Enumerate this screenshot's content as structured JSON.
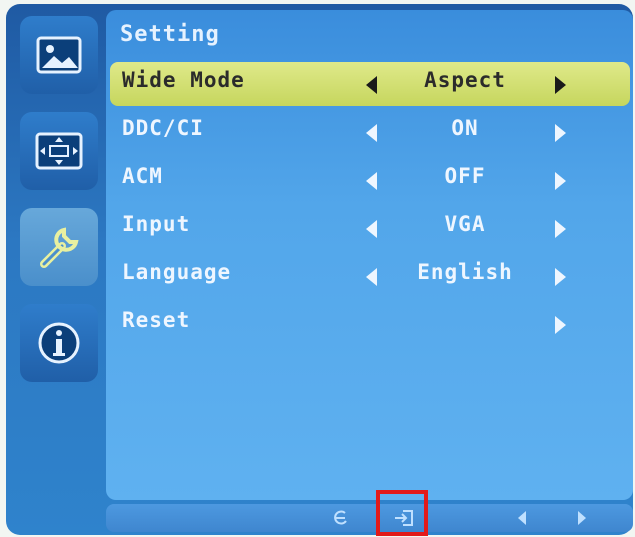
{
  "osd": {
    "title": "Setting",
    "sidebar": [
      {
        "icon": "picture-icon",
        "active": false
      },
      {
        "icon": "display-position-icon",
        "active": false
      },
      {
        "icon": "wrench-settings-icon",
        "active": true
      },
      {
        "icon": "info-icon",
        "active": false
      }
    ],
    "rows": [
      {
        "label": "Wide Mode",
        "value": "Aspect",
        "selected": true,
        "left_arrow": true
      },
      {
        "label": "DDC/CI",
        "value": "ON",
        "selected": false,
        "left_arrow": true
      },
      {
        "label": "ACM",
        "value": "OFF",
        "selected": false,
        "left_arrow": true
      },
      {
        "label": "Input",
        "value": "VGA",
        "selected": false,
        "left_arrow": true
      },
      {
        "label": "Language",
        "value": "English",
        "selected": false,
        "left_arrow": true
      },
      {
        "label": "Reset",
        "value": "",
        "selected": false,
        "left_arrow": false
      }
    ],
    "footer_buttons": [
      "eco-icon",
      "exit-icon",
      "left-arrow-icon",
      "right-arrow-icon"
    ]
  },
  "colors": {
    "highlight": "#c6d65d",
    "panel": "#52a6ea",
    "annotation": "#e21a1a"
  }
}
